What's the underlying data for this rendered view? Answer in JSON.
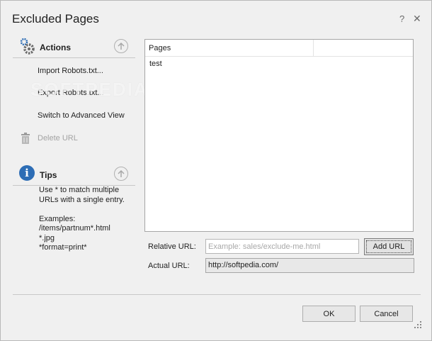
{
  "window": {
    "title": "Excluded Pages",
    "help_glyph": "?",
    "close_glyph": "✕"
  },
  "actions": {
    "header": "Actions",
    "items": [
      {
        "label": "Import Robots.txt...",
        "enabled": true
      },
      {
        "label": "Export Robots.txt...",
        "enabled": true
      },
      {
        "label": "Switch to Advanced View",
        "enabled": true
      },
      {
        "label": "Delete URL",
        "enabled": false
      }
    ]
  },
  "tips": {
    "header": "Tips",
    "text": "Use * to match multiple\nURLs with a single entry.\n\nExamples:\n/items/partnum*.html\n*.jpg\n*format=print*"
  },
  "pages_list": {
    "column": "Pages",
    "rows": [
      "test"
    ]
  },
  "relative_url": {
    "label": "Relative URL:",
    "placeholder": "Example: sales/exclude-me.html",
    "value": ""
  },
  "add_button": "Add URL",
  "actual_url": {
    "label": "Actual URL:",
    "value": "http://softpedia.com/"
  },
  "buttons": {
    "ok": "OK",
    "cancel": "Cancel"
  },
  "watermark": "SOFTPEDIA",
  "colors": {
    "accent": "#2d6db5",
    "background": "#f0f0f0"
  }
}
